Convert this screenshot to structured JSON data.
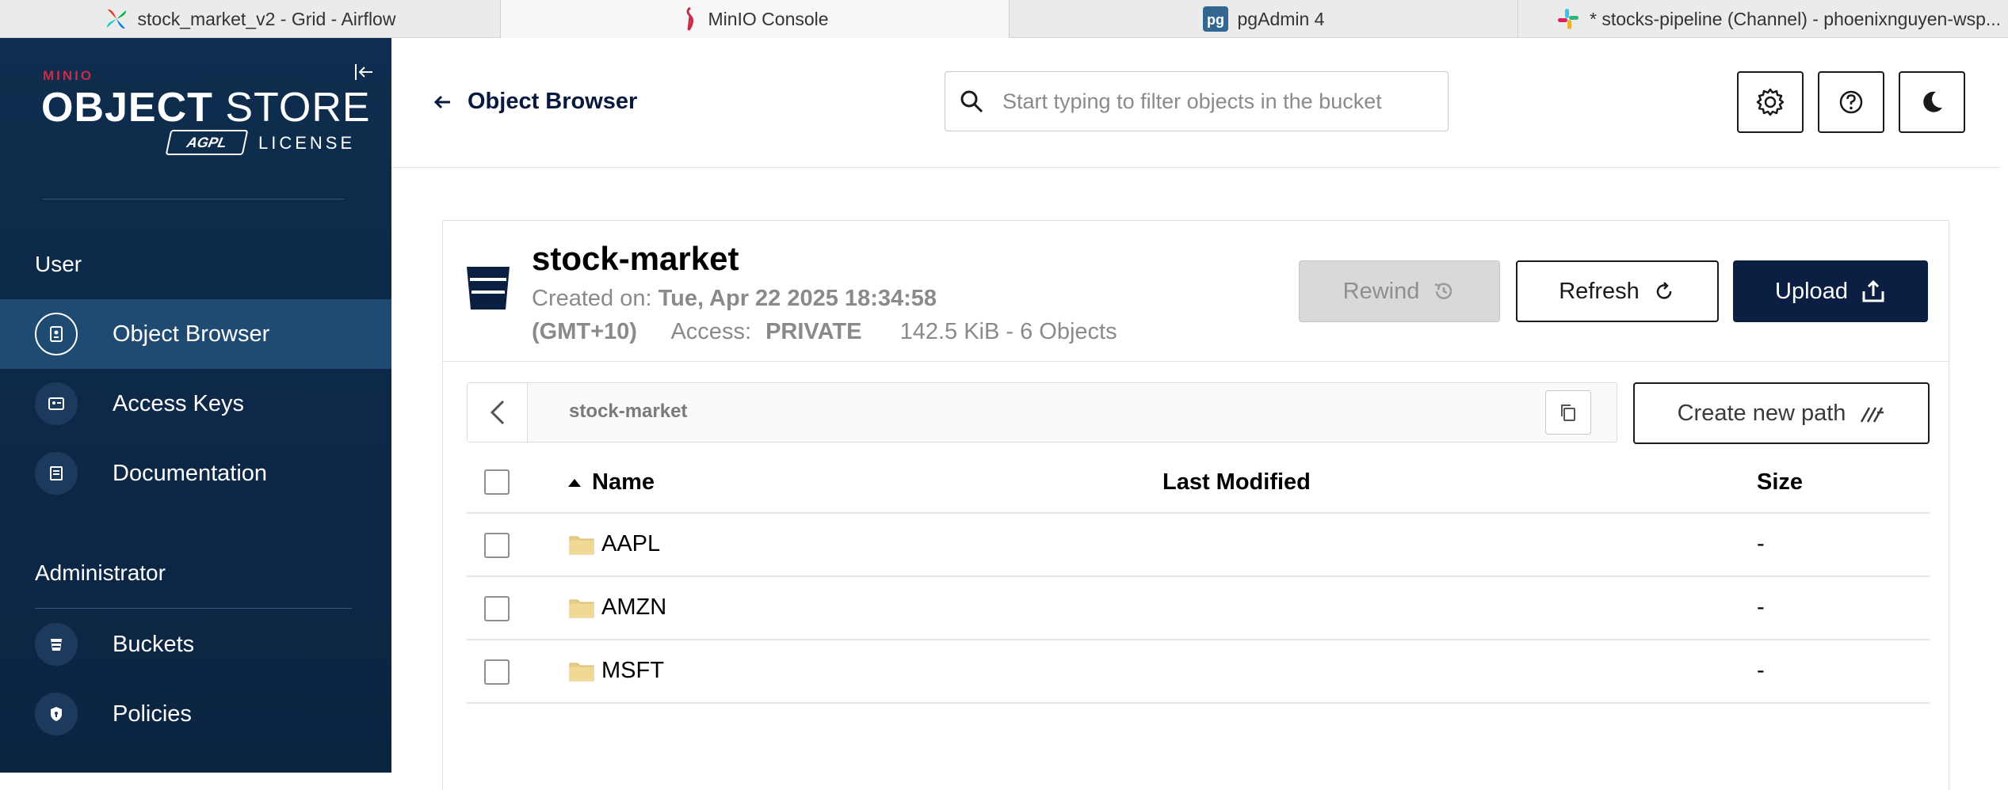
{
  "browser_tabs": [
    {
      "title": "stock_market_v2 - Grid - Airflow",
      "icon": "airflow-icon"
    },
    {
      "title": "MinIO Console",
      "icon": "minio-icon"
    },
    {
      "title": "pgAdmin 4",
      "icon": "pgadmin-icon"
    },
    {
      "title": "* stocks-pipeline (Channel) - phoenixnguyen-wsp...",
      "icon": "slack-icon"
    }
  ],
  "sidebar": {
    "brand_top": "MINIO",
    "brand_main_bold": "OBJECT",
    "brand_main_light": " STORE",
    "brand_badge": "AGPL",
    "brand_license": "LICENSE",
    "sections": [
      {
        "label": "User",
        "items": [
          {
            "label": "Object Browser",
            "icon": "object-browser-icon",
            "active": true
          },
          {
            "label": "Access Keys",
            "icon": "access-keys-icon",
            "active": false
          },
          {
            "label": "Documentation",
            "icon": "documentation-icon",
            "active": false
          }
        ]
      },
      {
        "label": "Administrator",
        "items": [
          {
            "label": "Buckets",
            "icon": "buckets-icon",
            "active": false
          },
          {
            "label": "Policies",
            "icon": "policies-icon",
            "active": false
          }
        ]
      }
    ]
  },
  "header": {
    "back_label": "Object Browser",
    "search_placeholder": "Start typing to filter objects in the bucket"
  },
  "bucket": {
    "name": "stock-market",
    "created_label": "Created on: ",
    "created_value": "Tue, Apr 22 2025 18:34:58",
    "timezone": "(GMT+10)",
    "access_label": "Access: ",
    "access_value": "PRIVATE",
    "usage": "142.5 KiB - 6 Objects"
  },
  "actions": {
    "rewind": "Rewind",
    "refresh": "Refresh",
    "upload": "Upload",
    "create_path": "Create new path"
  },
  "path": {
    "current": "stock-market"
  },
  "table": {
    "columns": {
      "name": "Name",
      "modified": "Last Modified",
      "size": "Size"
    },
    "rows": [
      {
        "name": "AAPL",
        "modified": "",
        "size": "-"
      },
      {
        "name": "AMZN",
        "modified": "",
        "size": "-"
      },
      {
        "name": "MSFT",
        "modified": "",
        "size": "-"
      }
    ]
  },
  "colors": {
    "sidebar_bg": "#0f2d4e",
    "sidebar_active": "#1f4a72",
    "primary_button": "#0a1f42",
    "brand_red": "#c72c48",
    "folder": "#e8cf85"
  }
}
